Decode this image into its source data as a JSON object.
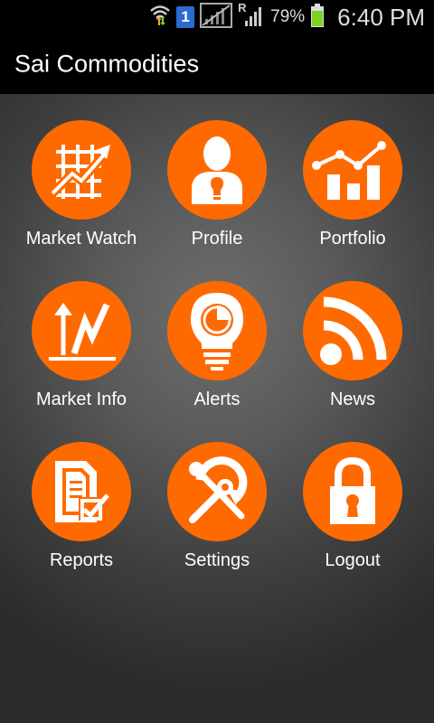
{
  "status_bar": {
    "sim_slot": "1",
    "roaming_indicator": "R",
    "battery_percent": "79%",
    "time": "6:40 PM",
    "icons": [
      "wifi-icon",
      "data-transfer-icon",
      "sim-icon",
      "no-signal-icon",
      "signal-icon",
      "battery-icon"
    ]
  },
  "app": {
    "title": "Sai Commodities"
  },
  "menu": [
    {
      "label": "Market Watch",
      "icon": "market-watch-icon"
    },
    {
      "label": "Profile",
      "icon": "profile-icon"
    },
    {
      "label": "Portfolio",
      "icon": "portfolio-icon"
    },
    {
      "label": "Market Info",
      "icon": "market-info-icon"
    },
    {
      "label": "Alerts",
      "icon": "alerts-icon"
    },
    {
      "label": "News",
      "icon": "news-icon"
    },
    {
      "label": "Reports",
      "icon": "reports-icon"
    },
    {
      "label": "Settings",
      "icon": "settings-icon"
    },
    {
      "label": "Logout",
      "icon": "logout-icon"
    }
  ],
  "colors": {
    "accent": "#ff6a00",
    "title_bar": "#000000",
    "label_text": "#ffffff",
    "battery": "#7ed321"
  }
}
